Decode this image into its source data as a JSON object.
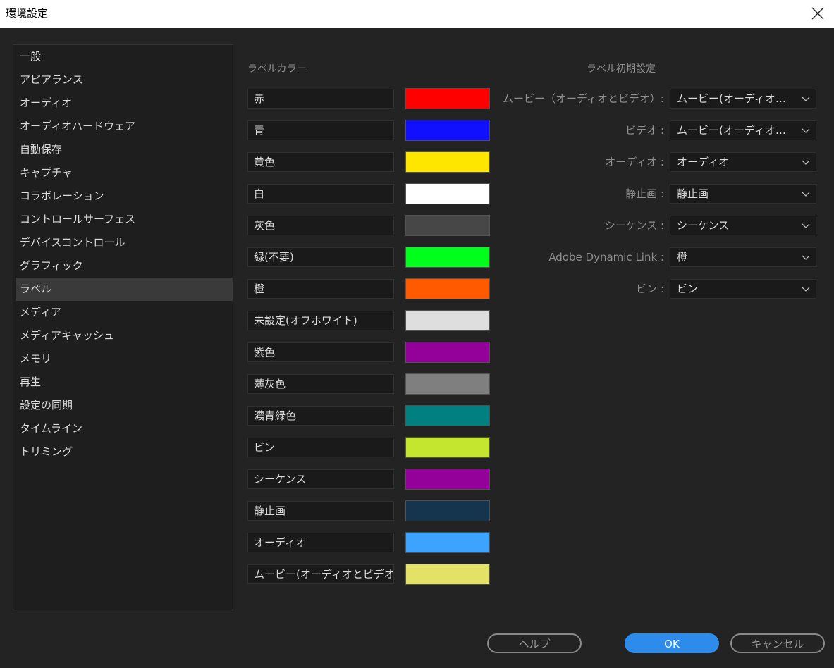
{
  "window": {
    "title": "環境設定"
  },
  "sidebar": {
    "items": [
      {
        "label": "一般"
      },
      {
        "label": "アピアランス"
      },
      {
        "label": "オーディオ"
      },
      {
        "label": "オーディオハードウェア"
      },
      {
        "label": "自動保存"
      },
      {
        "label": "キャプチャ"
      },
      {
        "label": "コラボレーション"
      },
      {
        "label": "コントロールサーフェス"
      },
      {
        "label": "デバイスコントロール"
      },
      {
        "label": "グラフィック"
      },
      {
        "label": "ラベル",
        "selected": true
      },
      {
        "label": "メディア"
      },
      {
        "label": "メディアキャッシュ"
      },
      {
        "label": "メモリ"
      },
      {
        "label": "再生"
      },
      {
        "label": "設定の同期"
      },
      {
        "label": "タイムライン"
      },
      {
        "label": "トリミング"
      }
    ]
  },
  "label_colors": {
    "header": "ラベルカラー",
    "items": [
      {
        "name": "赤",
        "color": "#ff0000"
      },
      {
        "name": "青",
        "color": "#1010ff"
      },
      {
        "name": "黄色",
        "color": "#ffe600"
      },
      {
        "name": "白",
        "color": "#ffffff"
      },
      {
        "name": "灰色",
        "color": "#474747"
      },
      {
        "name": "緑(不要)",
        "color": "#00ff1a"
      },
      {
        "name": "橙",
        "color": "#ff5a00"
      },
      {
        "name": "未設定(オフホワイト)",
        "color": "#dedede"
      },
      {
        "name": "紫色",
        "color": "#93009a"
      },
      {
        "name": "薄灰色",
        "color": "#7f7f7f"
      },
      {
        "name": "濃青緑色",
        "color": "#008080"
      },
      {
        "name": "ビン",
        "color": "#c4e62e"
      },
      {
        "name": "シーケンス",
        "color": "#93009a"
      },
      {
        "name": "静止画",
        "color": "#15354f"
      },
      {
        "name": "オーディオ",
        "color": "#3ca3ff"
      },
      {
        "name": "ムービー(オーディオとビデオ)",
        "color": "#e4e167"
      }
    ]
  },
  "label_defaults": {
    "header": "ラベル初期設定",
    "items": [
      {
        "label": "ムービー（オーディオとビデオ）:",
        "value": "ムービー(オーディオとビデオ)"
      },
      {
        "label": "ビデオ :",
        "value": "ムービー(オーディオとビデオ)"
      },
      {
        "label": "オーディオ :",
        "value": "オーディオ"
      },
      {
        "label": "静止画 :",
        "value": "静止画"
      },
      {
        "label": "シーケンス :",
        "value": "シーケンス"
      },
      {
        "label": "Adobe Dynamic Link :",
        "value": "橙"
      },
      {
        "label": "ビン :",
        "value": "ビン"
      }
    ]
  },
  "buttons": {
    "help": "ヘルプ",
    "ok": "OK",
    "cancel": "キャンセル"
  },
  "icons": {
    "close": "close-icon",
    "chevron": "chevron-down-icon"
  }
}
